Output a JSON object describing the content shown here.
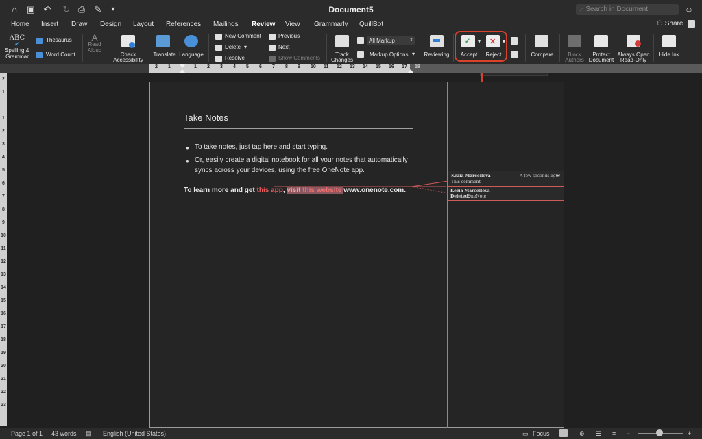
{
  "window": {
    "title": "Document5",
    "search_placeholder": "Search in Document"
  },
  "tabs": [
    {
      "label": "Home"
    },
    {
      "label": "Insert"
    },
    {
      "label": "Draw"
    },
    {
      "label": "Design"
    },
    {
      "label": "Layout"
    },
    {
      "label": "References"
    },
    {
      "label": "Mailings"
    },
    {
      "label": "Review",
      "active": true
    },
    {
      "label": "View"
    },
    {
      "label": "Grammarly"
    },
    {
      "label": "QuillBot"
    }
  ],
  "share_label": "Share",
  "ribbon": {
    "spelling": "Spelling &",
    "spelling2": "Grammar",
    "thesaurus": "Thesaurus",
    "word_count": "Word Count",
    "read_aloud": "Read",
    "read_aloud2": "Aloud",
    "check_accessibility": "Check",
    "check_accessibility2": "Accessibility",
    "translate": "Translate",
    "language": "Language",
    "new_comment": "New Comment",
    "delete": "Delete",
    "resolve": "Resolve",
    "previous": "Previous",
    "next": "Next",
    "show_comments": "Show Comments",
    "track_changes": "Track",
    "track_changes2": "Changes",
    "markup_select": "All Markup",
    "markup_options": "Markup Options",
    "reviewing": "Reviewing",
    "accept": "Accept",
    "reject": "Reject",
    "compare": "Compare",
    "block_authors": "Block",
    "block_authors2": "Authors",
    "protect_document": "Protect",
    "protect_document2": "Document",
    "always_open": "Always Open",
    "always_open2": "Read-Only",
    "hide_ink": "Hide Ink"
  },
  "tooltip": "Accept and Move to Next",
  "ruler": {
    "h": [
      "2",
      "1",
      "1",
      "2",
      "3",
      "4",
      "5",
      "6",
      "7",
      "8",
      "9",
      "10",
      "11",
      "12",
      "13",
      "14",
      "15",
      "16",
      "17",
      "18"
    ],
    "v": [
      "2",
      "1",
      "1",
      "2",
      "3",
      "4",
      "5",
      "6",
      "7",
      "8",
      "9",
      "10",
      "11",
      "12",
      "13",
      "14",
      "15",
      "16",
      "17",
      "18",
      "19",
      "20",
      "21",
      "22",
      "23"
    ]
  },
  "document": {
    "heading": "Take Notes",
    "bullet1": "To take notes, just tap here and start typing.",
    "bullet2a": "Or, easily create a digital notebook for all your notes that automatically",
    "bullet2b": "syncs across your devices, using the free OneNote app.",
    "para_start": "To learn more and get ",
    "para_ins1": "this app",
    "para_comma": ", ",
    "para_sel1": "visit",
    "para_sel2": " this website ",
    "para_link": "www.onenote.com",
    "para_end": "."
  },
  "comments": {
    "author": "Kezia Marcellova",
    "time": "A few seconds ago",
    "text": "This comment",
    "deleted_label": "Deleted:",
    "deleted_text": "OneNote"
  },
  "status": {
    "page": "Page 1 of 1",
    "words": "43 words",
    "language": "English (United States)",
    "focus": "Focus"
  },
  "colors": {
    "accent_red": "#d9412b",
    "insert_red": "#e05a5a",
    "accept_green": "#3aa15a",
    "reject_red": "#d33b3b",
    "reviewing_blue": "#2f7fd8"
  }
}
